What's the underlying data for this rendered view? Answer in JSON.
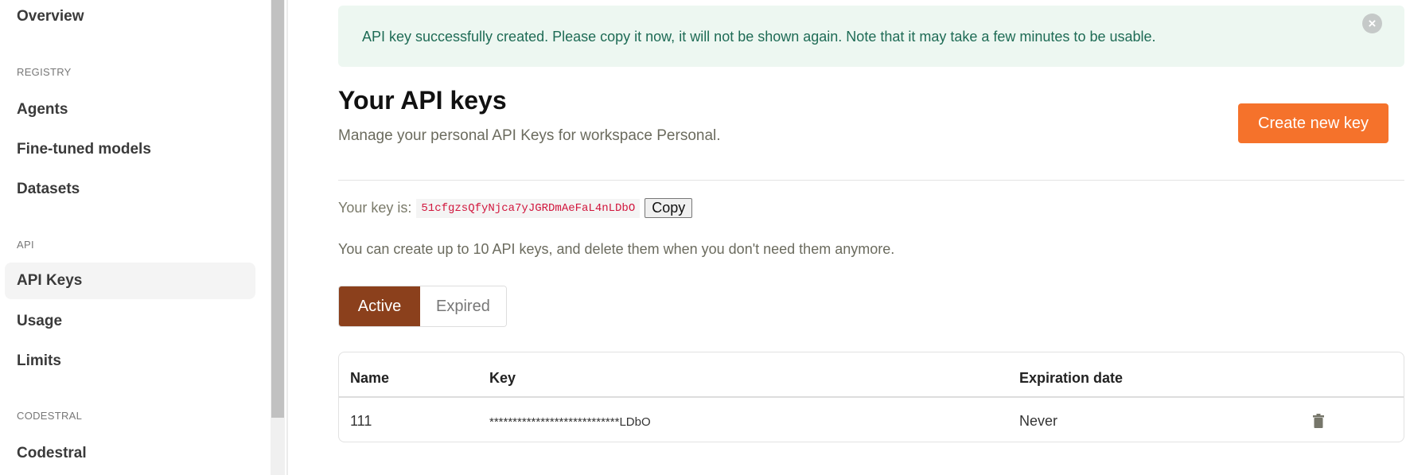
{
  "sidebar": {
    "overview": "Overview",
    "registry_label": "REGISTRY",
    "agents": "Agents",
    "fine_tuned": "Fine-tuned models",
    "datasets": "Datasets",
    "api_label": "API",
    "api_keys": "API Keys",
    "usage": "Usage",
    "limits": "Limits",
    "codestral_label": "CODESTRAL",
    "codestral": "Codestral"
  },
  "alert": {
    "message": "API key successfully created. Please copy it now, it will not be shown again. Note that it may take a few minutes to be usable.",
    "close_icon": "close-circle-icon"
  },
  "header": {
    "title": "Your API keys",
    "subtitle": "Manage your personal API Keys for workspace Personal.",
    "create_button": "Create new key"
  },
  "new_key": {
    "label": "Your key is:",
    "value": "51cfgzsQfyNjca7yJGRDmAeFaL4nLDbO",
    "copy_button": "Copy"
  },
  "info": "You can create up to 10 API keys, and delete them when you don't need them anymore.",
  "tabs": [
    {
      "label": "Active",
      "selected": true
    },
    {
      "label": "Expired",
      "selected": false
    }
  ],
  "table": {
    "columns": [
      "Name",
      "Key",
      "Expiration date"
    ],
    "rows": [
      {
        "name": "111",
        "key": "****************************LDbO",
        "expiration": "Never",
        "action_icon": "trash-icon"
      }
    ]
  },
  "colors": {
    "accent": "#f5722b",
    "active_tab": "#8b401c",
    "alert_bg": "#edf7f1",
    "key_text": "#d1163d"
  }
}
